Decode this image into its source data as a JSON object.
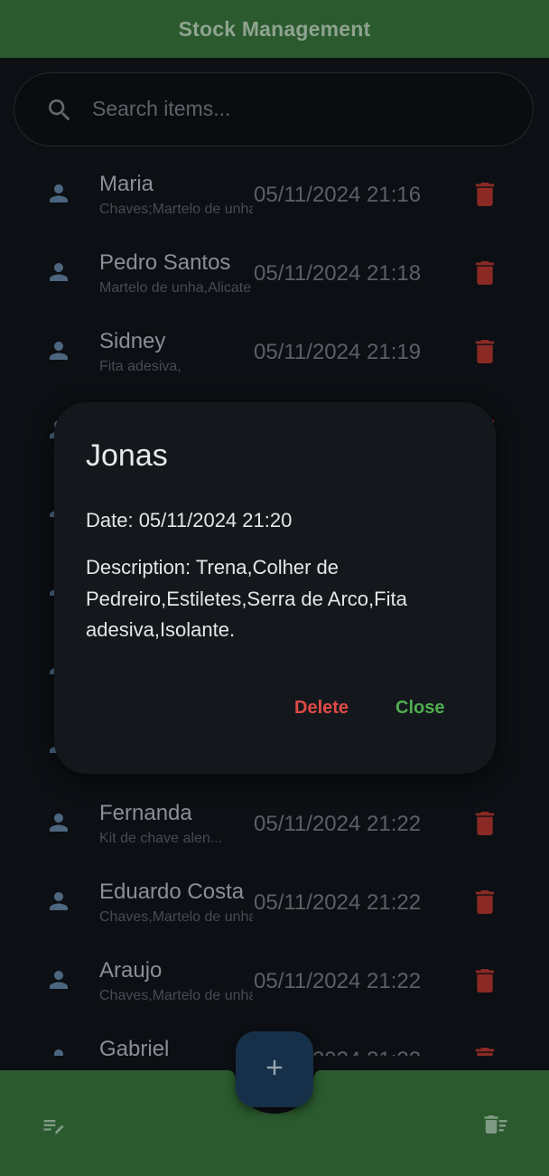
{
  "appbar": {
    "title": "Stock Management"
  },
  "search": {
    "placeholder": "Search items..."
  },
  "items": [
    {
      "name": "Maria",
      "description": "Chaves;Martelo de unha",
      "date": "05/11/2024 21:16"
    },
    {
      "name": "Pedro Santos",
      "description": "Martelo de unha,Alicate",
      "date": "05/11/2024 21:18"
    },
    {
      "name": "Sidney",
      "description": "Fita adesiva,",
      "date": "05/11/2024 21:19"
    },
    {
      "name": "",
      "description": "",
      "date": ""
    },
    {
      "name": "",
      "description": "",
      "date": ""
    },
    {
      "name": "",
      "description": "",
      "date": ""
    },
    {
      "name": "",
      "description": "",
      "date": ""
    },
    {
      "name": "",
      "description": "",
      "date": ""
    },
    {
      "name": "Fernanda",
      "description": "Kit de chave alen...",
      "date": "05/11/2024 21:22"
    },
    {
      "name": "Eduardo Costa",
      "description": "Chaves,Martelo de unha",
      "date": "05/11/2024 21:22"
    },
    {
      "name": "Araujo",
      "description": "Chaves,Martelo de unha",
      "date": "05/11/2024 21:22"
    },
    {
      "name": "Gabriel",
      "description": "",
      "date": "05/11/2024 21:22"
    }
  ],
  "dialog": {
    "title": "Jonas",
    "date_line": "Date: 05/11/2024 21:20",
    "description_line": "Description: Trena,Colher de Pedreiro,Estiletes,Serra de Arco,Fita adesiva,Isolante.",
    "delete_label": "Delete",
    "close_label": "Close"
  },
  "fab": {
    "icon": "plus-icon"
  },
  "bottom_nav": {
    "left_icon": "edit-list-icon",
    "right_icon": "delete-sweep-icon"
  },
  "colors": {
    "appbar": "#2a5a2e",
    "background": "#0c0f13",
    "trash": "#8b2a24",
    "person": "#4c6680",
    "delete": "#e04a45",
    "close": "#4fae4f",
    "fab": "#173049"
  }
}
